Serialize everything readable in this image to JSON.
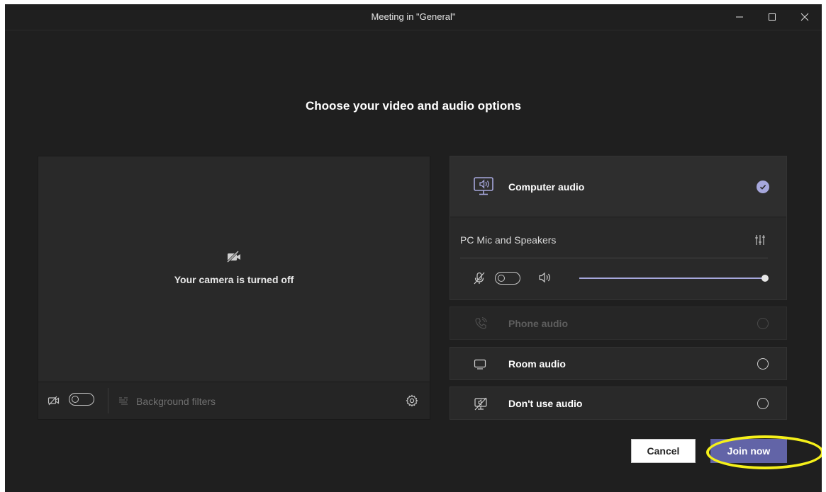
{
  "window": {
    "title": "Meeting in \"General\"",
    "controls": {
      "minimize": "minimize",
      "maximize": "maximize",
      "close": "close"
    }
  },
  "heading": "Choose your video and audio options",
  "video": {
    "camera_off_text": "Your camera is turned off",
    "camera_toggle_on": false,
    "background_filters_label": "Background filters",
    "background_filters_enabled": false
  },
  "audio": {
    "computer_audio": {
      "label": "Computer audio",
      "selected": true,
      "device_label": "PC Mic and Speakers",
      "mic_toggle_on": false,
      "speaker_volume_percent": 100
    },
    "options": [
      {
        "label": "Phone audio",
        "enabled": false,
        "selected": false
      },
      {
        "label": "Room audio",
        "enabled": true,
        "selected": false
      },
      {
        "label": "Don't use audio",
        "enabled": true,
        "selected": false
      }
    ]
  },
  "actions": {
    "cancel_label": "Cancel",
    "join_label": "Join now"
  },
  "colors": {
    "background": "#1f1f1f",
    "panel": "#292929",
    "accent": "#6264a7",
    "accent_light": "#a6a7dc",
    "highlight": "#f5f01a"
  },
  "icons": {
    "camera_off": "camera-off-icon",
    "computer_audio": "computer-audio-icon",
    "phone": "phone-icon",
    "room": "monitor-icon",
    "no_audio": "no-audio-icon",
    "mic_off": "mic-off-icon",
    "speaker": "speaker-icon",
    "device_settings": "equalizer-icon",
    "settings": "gear-icon",
    "background_filters": "background-filters-icon"
  }
}
